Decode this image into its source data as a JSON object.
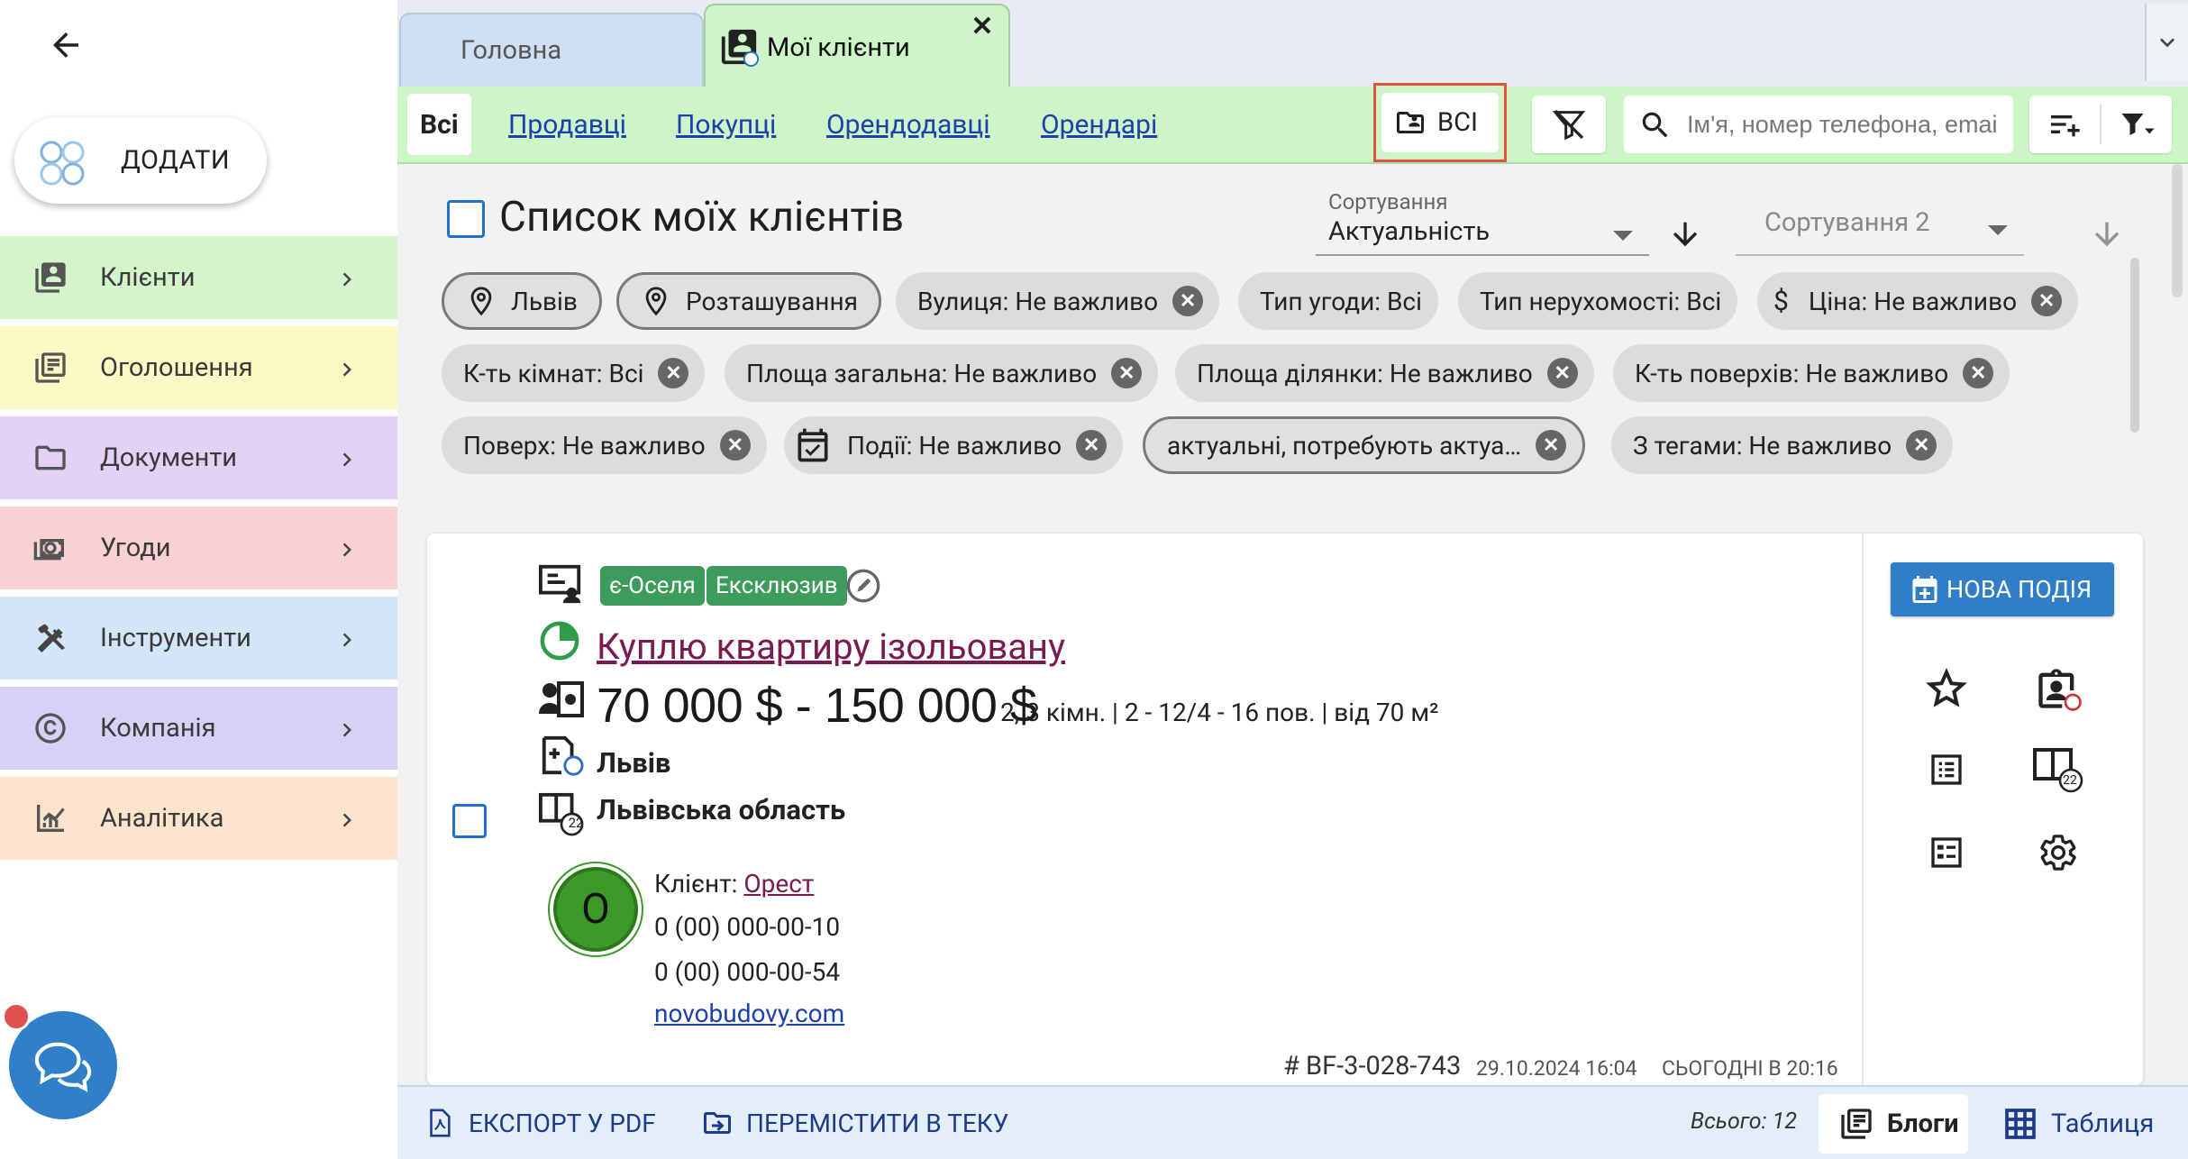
{
  "sidebar": {
    "add_label": "ДОДАТИ",
    "items": [
      {
        "label": "Клієнти",
        "color": "#d4f4cc"
      },
      {
        "label": "Оголошення",
        "color": "#fbfac4"
      },
      {
        "label": "Документи",
        "color": "#e3d2f6"
      },
      {
        "label": "Угоди",
        "color": "#f8d2d2"
      },
      {
        "label": "Інструменти",
        "color": "#d2e6f8"
      },
      {
        "label": "Компанія",
        "color": "#d6d2f6"
      },
      {
        "label": "Аналітика",
        "color": "#fbe3cc"
      }
    ]
  },
  "tabs": {
    "home": "Головна",
    "clients": "Мої клієнти",
    "close": "✕"
  },
  "filters": {
    "tabs": [
      "Всі",
      "Продавці",
      "Покупці",
      "Орендодавці",
      "Орендарі"
    ],
    "folder_label": "ВСІ",
    "search_placeholder": "Ім'я, номер телефона, emai"
  },
  "list": {
    "title": "Список моїх клієнтів",
    "sort_label": "Сортування",
    "sort_value": "Актуальність",
    "sort2_placeholder": "Сортування 2"
  },
  "chips": [
    [
      "Львів",
      "Розташування",
      "Вулиця: Не важливо",
      "Тип угоди: Всі",
      "Тип нерухомості: Всі",
      "Ціна: Не важливо"
    ],
    [
      "К-ть кімнат: Всі",
      "Площа загальна: Не важливо",
      "Площа ділянки: Не важливо",
      "К-ть поверхів: Не важливо"
    ],
    [
      "Поверх: Не важливо",
      "Події: Не важливо",
      "актуальні, потребують актуа…",
      "З тегами: Не важливо"
    ]
  ],
  "card": {
    "badges": [
      "є-Оселя",
      "Ексклюзив"
    ],
    "title": "Куплю квартиру ізольовану",
    "price": "70 000 $ - 150 000 $",
    "details": "2, 3 кімн. | 2 - 12/4 - 16 пов. | від 70 м²",
    "city": "Львів",
    "region": "Львівська область",
    "region_badge": "22",
    "avatar_letter": "О",
    "client_label": "Клієнт:",
    "client_name": "Орест",
    "phone1": "0 (00) 000-00-10",
    "phone2": "0 (00) 000-00-54",
    "site": "novobudovy.com",
    "ref": "# BF-3-028-743",
    "created": "29.10.2024 16:04",
    "updated": "СЬОГОДНІ В 20:16",
    "new_event": "НОВА ПОДІЯ",
    "docs_badge": "22"
  },
  "footer": {
    "export": "ЕКСПОРТ У PDF",
    "move": "ПЕРЕМІСТИТИ В ТЕКУ",
    "total": "Всього: 12",
    "view_blocks": "Блоги",
    "view_table": "Таблиця"
  },
  "colors": {
    "accent_green": "#cdf5c8",
    "link_blue": "#1e40af",
    "badge_green": "#3d9c5c",
    "button_blue": "#2f7ec7",
    "highlight_red": "#e0533f"
  }
}
